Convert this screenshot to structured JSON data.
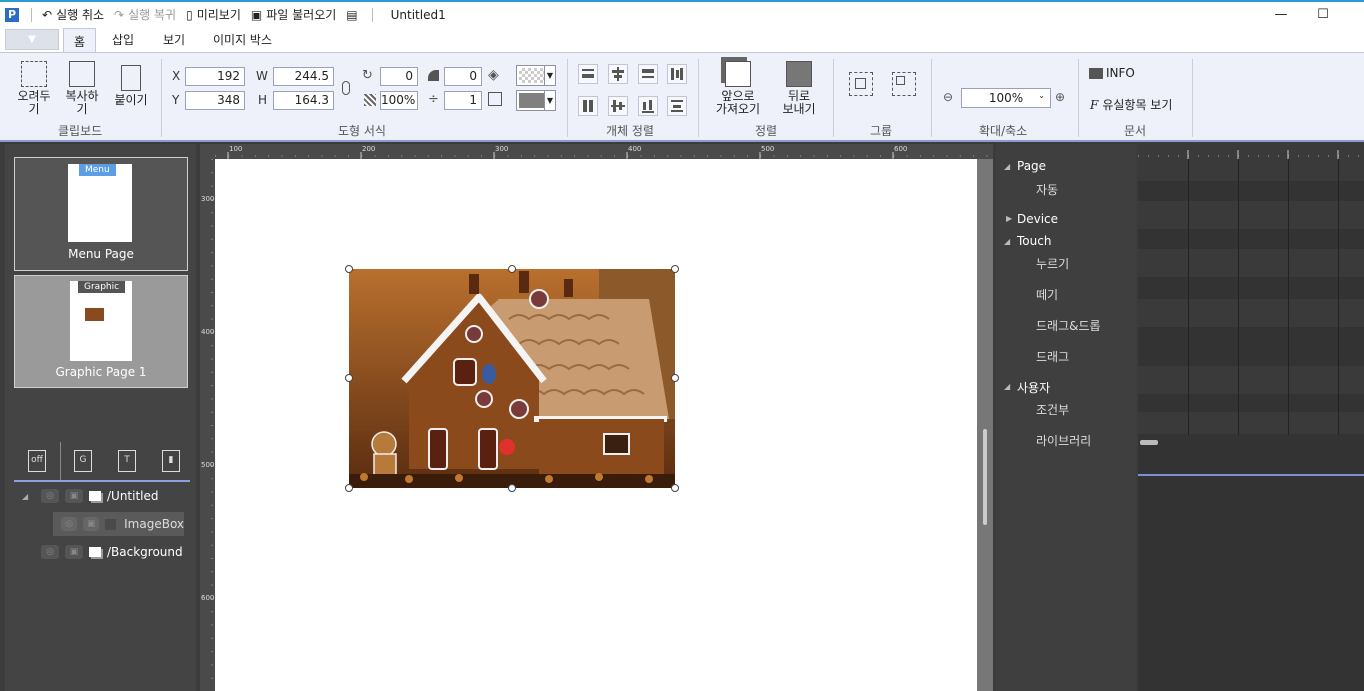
{
  "window": {
    "title": "Untitled1",
    "app_icon": "P",
    "quick_access": [
      {
        "icon": "undo-icon",
        "label": "실행 취소"
      },
      {
        "icon": "redo-icon",
        "label": "실행 복귀"
      },
      {
        "icon": "preview-icon",
        "label": "미리보기"
      },
      {
        "icon": "open-file-icon",
        "label": "파일 불러오기"
      }
    ],
    "minimize_glyph": "—",
    "maximize_glyph": "☐"
  },
  "tabs": [
    "홈",
    "삽입",
    "보기",
    "이미지 박스"
  ],
  "ribbon": {
    "clipboard": {
      "label": "클립보드",
      "cut": "오려두\n기",
      "copy": "복사하\n기",
      "paste": "붙이기"
    },
    "shape_format": {
      "label": "도형 서식",
      "x_label": "X",
      "x_value": "192",
      "y_label": "Y",
      "y_value": "348",
      "w_label": "W",
      "w_value": "244.5",
      "h_label": "H",
      "h_value": "164.3",
      "rotation": "0",
      "opacity": "100%",
      "corner": "0",
      "stroke_width": "1"
    },
    "align_objects": {
      "label": "개체 정렬"
    },
    "order": {
      "label": "정렬",
      "bring_forward": "앞으로\n가져오기",
      "send_backward": "뒤로\n보내기"
    },
    "group": {
      "label": "그룹"
    },
    "zoom": {
      "label": "확대/축소",
      "value": "100%"
    },
    "document": {
      "label": "문서",
      "info": "INFO",
      "properties": "유실항목 보기"
    }
  },
  "pages": [
    {
      "tag": "Menu",
      "caption": "Menu Page"
    },
    {
      "tag": "Graphic",
      "caption": "Graphic Page 1"
    }
  ],
  "layer_tools": [
    "off",
    "G",
    "T",
    "trash"
  ],
  "layers": [
    {
      "name": "/Untitled"
    },
    {
      "name": "ImageBox"
    },
    {
      "name": "/Background"
    }
  ],
  "rulers": {
    "h_labels": [
      "100",
      "200",
      "300",
      "400",
      "500",
      "600"
    ],
    "v_labels": [
      "300",
      "400",
      "500",
      "600"
    ]
  },
  "events": {
    "page": "Page",
    "page_sub": "자동",
    "device": "Device",
    "touch": "Touch",
    "touch_subs": [
      "누르기",
      "떼기",
      "드래그&드롭",
      "드래그"
    ],
    "user": "사용자",
    "user_subs": [
      "조건부",
      "라이브러리"
    ]
  },
  "colors": {
    "accent": "#2a9bd7",
    "ribbon_bg": "#eef1f9",
    "selection_line": "#8d9fe0",
    "menu_tag": "#5b9ee6",
    "graphic_tag": "#555555"
  }
}
